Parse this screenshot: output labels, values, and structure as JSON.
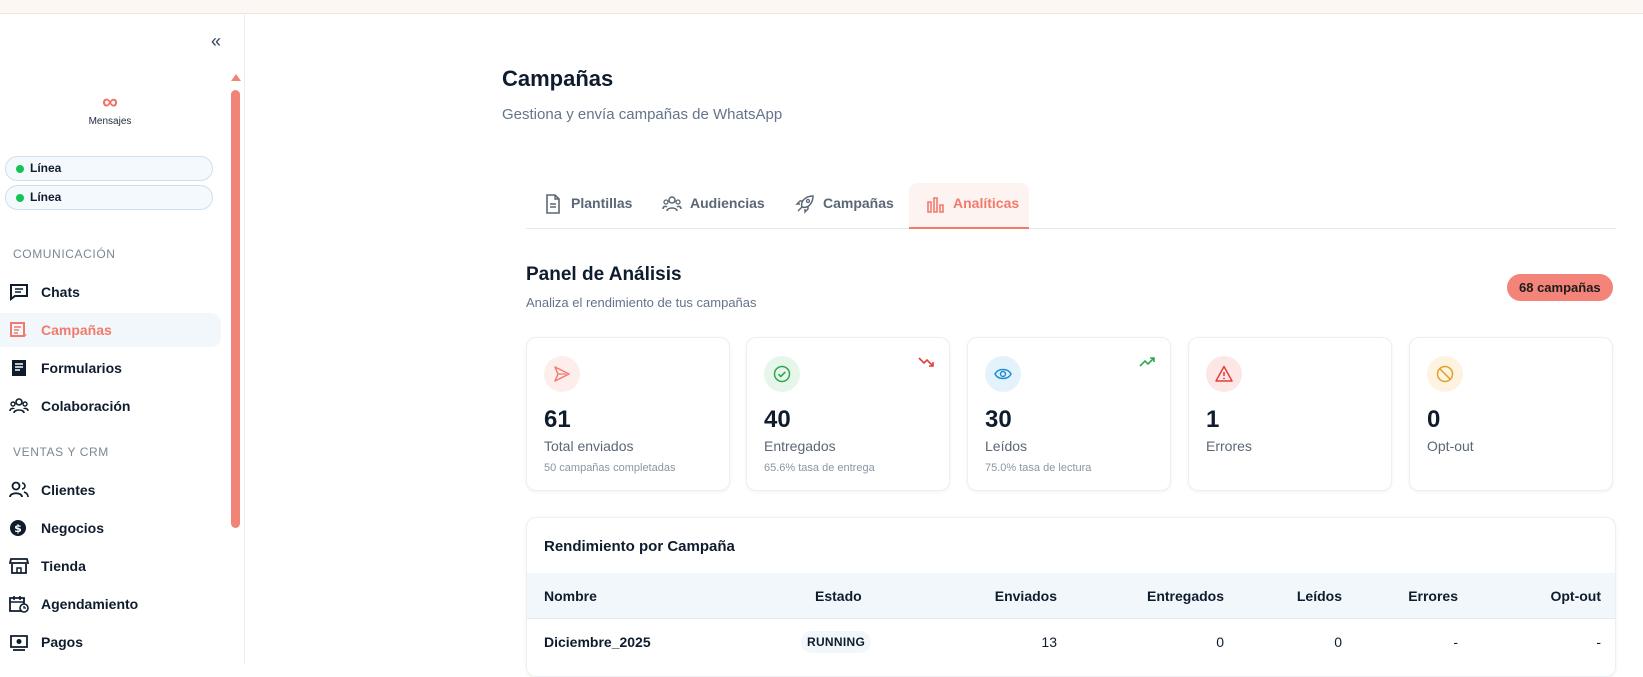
{
  "sidebar": {
    "collapse_icon": "chevrons-left-icon",
    "logo": {
      "mark": "∞",
      "text": "Mensajes"
    },
    "lines": [
      {
        "label": "Línea",
        "status_color": "#16c25a"
      },
      {
        "label": "Línea",
        "status_color": "#16c25a"
      }
    ],
    "sections": [
      {
        "title": "COMUNICACIÓN",
        "items": [
          {
            "label": "Chats",
            "icon": "message-square-icon",
            "active": false
          },
          {
            "label": "Campañas",
            "icon": "megaphone-list-icon",
            "active": true
          },
          {
            "label": "Formularios",
            "icon": "form-icon",
            "active": false
          },
          {
            "label": "Colaboración",
            "icon": "team-icon",
            "active": false
          }
        ]
      },
      {
        "title": "VENTAS Y CRM",
        "items": [
          {
            "label": "Clientes",
            "icon": "users-icon",
            "active": false
          },
          {
            "label": "Negocios",
            "icon": "dollar-circle-icon",
            "active": false
          },
          {
            "label": "Tienda",
            "icon": "store-icon",
            "active": false
          },
          {
            "label": "Agendamiento",
            "icon": "calendar-clock-icon",
            "active": false
          },
          {
            "label": "Pagos",
            "icon": "payment-icon",
            "active": false
          }
        ]
      }
    ]
  },
  "header": {
    "title": "Campañas",
    "subtitle": "Gestiona y envía campañas de WhatsApp"
  },
  "tabs": [
    {
      "label": "Plantillas",
      "icon": "file-icon",
      "active": false
    },
    {
      "label": "Audiencias",
      "icon": "users-icon",
      "active": false
    },
    {
      "label": "Campañas",
      "icon": "rocket-icon",
      "active": false
    },
    {
      "label": "Analíticas",
      "icon": "bar-chart-icon",
      "active": true
    }
  ],
  "panel": {
    "title": "Panel de Análisis",
    "subtitle": "Analiza el rendimiento de tus campañas",
    "badge": "68 campañas"
  },
  "stats": [
    {
      "value": "61",
      "label": "Total enviados",
      "sub": "50 campañas completadas",
      "icon": "send-icon",
      "color": "#f27a6d",
      "bg": "#fdeeec",
      "trend": null
    },
    {
      "value": "40",
      "label": "Entregados",
      "sub": "65.6% tasa de entrega",
      "icon": "check-circle-icon",
      "color": "#2fa84f",
      "bg": "#e6f6ea",
      "trend": "down"
    },
    {
      "value": "30",
      "label": "Leídos",
      "sub": "75.0% tasa de lectura",
      "icon": "eye-icon",
      "color": "#1f8fd1",
      "bg": "#e4f2fb",
      "trend": "up"
    },
    {
      "value": "1",
      "label": "Errores",
      "sub": "",
      "icon": "alert-triangle-icon",
      "color": "#e0413a",
      "bg": "#fde7e6",
      "trend": null
    },
    {
      "value": "0",
      "label": "Opt-out",
      "sub": "",
      "icon": "ban-icon",
      "color": "#e2a12a",
      "bg": "#fdf3e0",
      "trend": null
    }
  ],
  "table": {
    "title": "Rendimiento por Campaña",
    "columns": [
      "Nombre",
      "Estado",
      "Enviados",
      "Entregados",
      "Leídos",
      "Errores",
      "Opt-out"
    ],
    "rows": [
      {
        "nombre": "Diciembre_2025",
        "estado": "RUNNING",
        "enviados": "13",
        "entregados": "0",
        "leidos": "0",
        "errores": "-",
        "optout": "-"
      }
    ]
  }
}
